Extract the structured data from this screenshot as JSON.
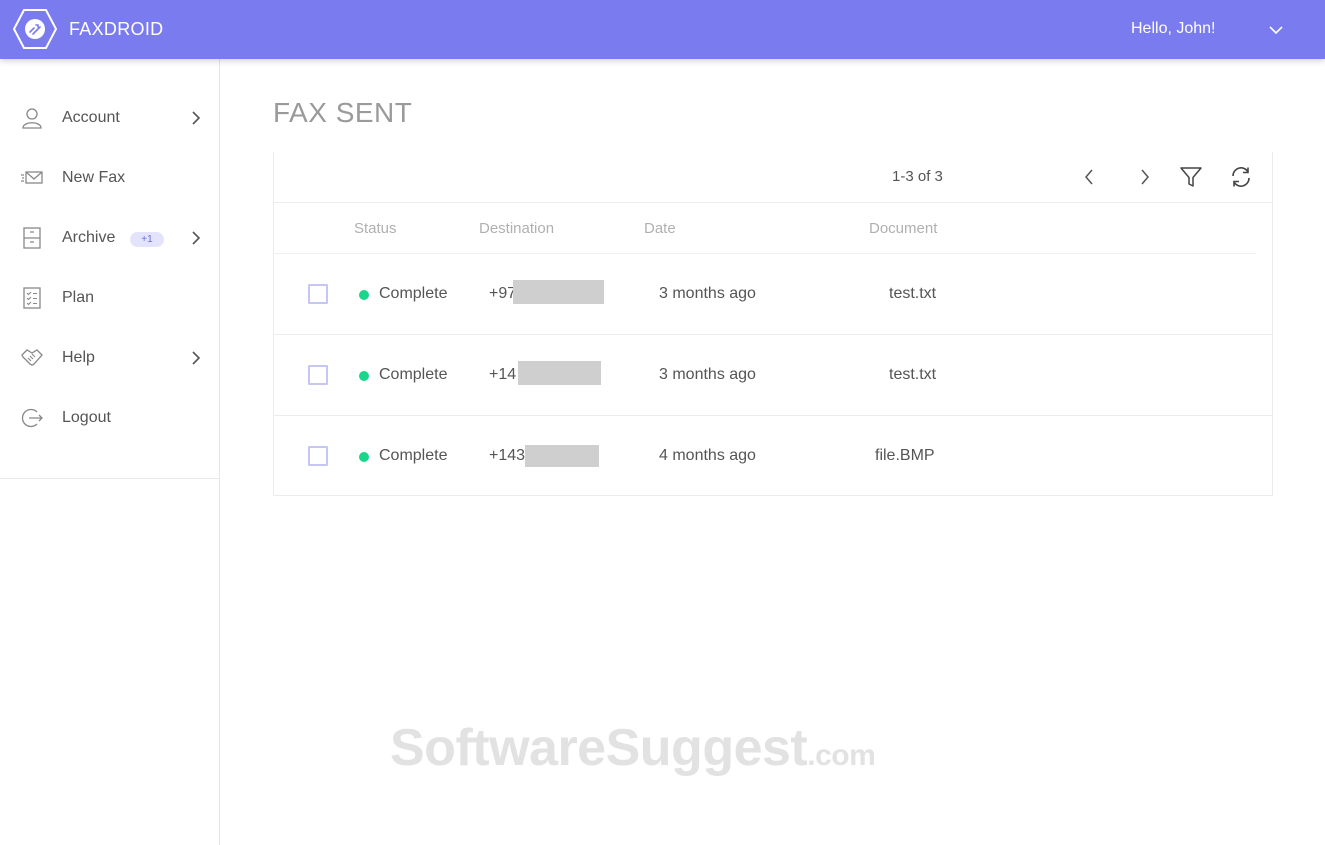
{
  "header": {
    "brand": "FAXDROID",
    "greeting": "Hello, John!"
  },
  "sidebar": {
    "items": [
      {
        "label": "Account",
        "icon": "user-icon",
        "has_submenu": true
      },
      {
        "label": "New Fax",
        "icon": "envelope-icon",
        "has_submenu": false
      },
      {
        "label": "Archive",
        "icon": "cabinet-icon",
        "badge": "+1",
        "has_submenu": true
      },
      {
        "label": "Plan",
        "icon": "checklist-icon",
        "has_submenu": false
      },
      {
        "label": "Help",
        "icon": "handshake-icon",
        "has_submenu": true
      },
      {
        "label": "Logout",
        "icon": "logout-icon",
        "has_submenu": false
      }
    ]
  },
  "main": {
    "title": "FAX SENT",
    "pagination": "1-3 of 3",
    "columns": [
      "Status",
      "Destination",
      "Date",
      "Document"
    ],
    "rows": [
      {
        "status": "Complete",
        "destination": "+97",
        "date": "3 months ago",
        "document": "test.txt"
      },
      {
        "status": "Complete",
        "destination": "+14",
        "date": "3 months ago",
        "document": "test.txt"
      },
      {
        "status": "Complete",
        "destination": "+143",
        "date": "4 months ago",
        "document": "file.BMP"
      }
    ]
  },
  "watermark": {
    "name": "SoftwareSuggest",
    "tld": ".com"
  },
  "colors": {
    "header_bg": "#7a7bef",
    "status_complete": "#19d68a",
    "checkbox_border": "#c5c6f3",
    "badge_bg": "#e3e4fb"
  }
}
